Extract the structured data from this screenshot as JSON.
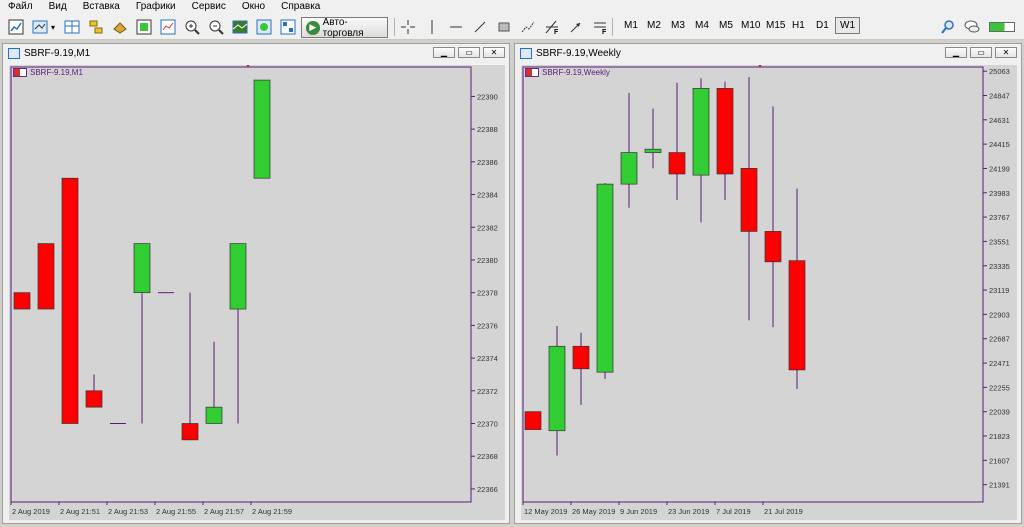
{
  "menu": [
    "Файл",
    "Вид",
    "Вставка",
    "Графики",
    "Сервис",
    "Окно",
    "Справка"
  ],
  "toolbar": {
    "autotrade_label": "Авто-торговля",
    "timeframes": [
      "M1",
      "M2",
      "M3",
      "M4",
      "M5",
      "M10",
      "M15",
      "H1",
      "D1",
      "W1"
    ],
    "selected_timeframe": "W1",
    "icons": [
      "new-chart-icon",
      "chart-type-icon",
      "market-watch-icon",
      "navigator-icon",
      "data-window-icon",
      "strategy-tester-icon",
      "zoom-in-icon",
      "zoom-out-icon",
      "tile-windows-icon",
      "crosshair-icon",
      "vertical-line-icon",
      "horizontal-line-icon",
      "trendline-icon",
      "rectangle-icon",
      "fibonacci-icon",
      "arrow-icon",
      "text-label-icon",
      "search-icon",
      "chat-icon"
    ],
    "connection_color": "#3cc33c"
  },
  "windows": [
    {
      "title": "SBRF-9.19,M1",
      "symbol_label": "SBRF-9.19,M1"
    },
    {
      "title": "SBRF-9.19,Weekly",
      "symbol_label": "SBRF-9.19,Weekly"
    }
  ],
  "chart_data": [
    {
      "type": "candlestick",
      "title": "SBRF-9.19,M1",
      "y_ticks": [
        22390,
        22388,
        22386,
        22384,
        22382,
        22380,
        22378,
        22376,
        22374,
        22372,
        22370,
        22368,
        22366
      ],
      "ylim": [
        22365.2,
        22391.8
      ],
      "x_tick_labels": [
        "2 Aug 2019",
        "2 Aug 21:51",
        "2 Aug 21:53",
        "2 Aug 21:55",
        "2 Aug 21:57",
        "2 Aug 21:59"
      ],
      "colors": {
        "bull": "#32cd32",
        "bear": "#ff0000",
        "wick": "#5a1a7a"
      },
      "candles": [
        {
          "o": 22378,
          "h": 22378,
          "l": 22377,
          "c": 22377
        },
        {
          "o": 22381,
          "h": 22381,
          "l": 22377,
          "c": 22377
        },
        {
          "o": 22385,
          "h": 22385,
          "l": 22370,
          "c": 22370
        },
        {
          "o": 22372,
          "h": 22373,
          "l": 22371,
          "c": 22371
        },
        {
          "o": 22370,
          "h": 22370,
          "l": 22370,
          "c": 22370
        },
        {
          "o": 22378,
          "h": 22381,
          "l": 22370,
          "c": 22381
        },
        {
          "o": 22378,
          "h": 22378,
          "l": 22378,
          "c": 22378
        },
        {
          "o": 22370,
          "h": 22378,
          "l": 22369,
          "c": 22369
        },
        {
          "o": 22370,
          "h": 22375,
          "l": 22370,
          "c": 22371
        },
        {
          "o": 22377,
          "h": 22381,
          "l": 22370,
          "c": 22381
        },
        {
          "o": 22385,
          "h": 22391,
          "l": 22385,
          "c": 22391
        }
      ]
    },
    {
      "type": "candlestick",
      "title": "SBRF-9.19,Weekly",
      "y_ticks": [
        25063,
        24847,
        24631,
        24415,
        24199,
        23983,
        23767,
        23551,
        23335,
        23119,
        22903,
        22687,
        22471,
        22255,
        22039,
        21823,
        21607,
        21391
      ],
      "ylim": [
        21237,
        25100
      ],
      "x_tick_labels": [
        "12 May 2019",
        "26 May 2019",
        "9 Jun 2019",
        "23 Jun 2019",
        "7 Jul 2019",
        "21 Jul 2019"
      ],
      "colors": {
        "bull": "#32cd32",
        "bear": "#ff0000",
        "wick": "#5a1a7a"
      },
      "candles": [
        {
          "o": 22039,
          "h": 22039,
          "l": 21880,
          "c": 21880
        },
        {
          "o": 21870,
          "h": 22800,
          "l": 21650,
          "c": 22620
        },
        {
          "o": 22620,
          "h": 22740,
          "l": 22100,
          "c": 22420
        },
        {
          "o": 22390,
          "h": 24070,
          "l": 22330,
          "c": 24060
        },
        {
          "o": 24060,
          "h": 24870,
          "l": 23850,
          "c": 24340
        },
        {
          "o": 24340,
          "h": 24730,
          "l": 24200,
          "c": 24370
        },
        {
          "o": 24340,
          "h": 24960,
          "l": 23920,
          "c": 24150
        },
        {
          "o": 24140,
          "h": 25000,
          "l": 23720,
          "c": 24910
        },
        {
          "o": 24910,
          "h": 24970,
          "l": 23920,
          "c": 24150
        },
        {
          "o": 24200,
          "h": 25010,
          "l": 22850,
          "c": 23640
        },
        {
          "o": 23640,
          "h": 24750,
          "l": 22790,
          "c": 23370
        },
        {
          "o": 23380,
          "h": 24020,
          "l": 22240,
          "c": 22410
        }
      ]
    }
  ]
}
